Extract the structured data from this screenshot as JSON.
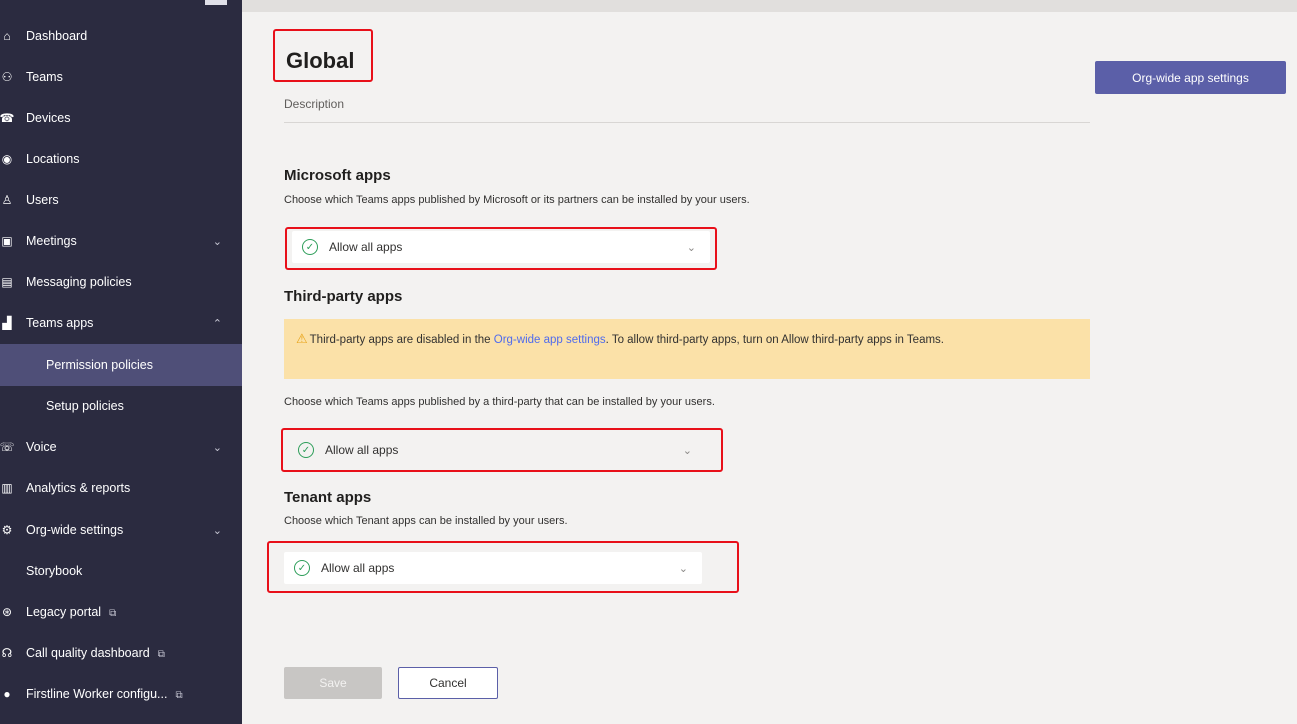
{
  "sidebar": {
    "items": [
      {
        "label": "Dashboard",
        "icon": "home-icon"
      },
      {
        "label": "Teams",
        "icon": "teams-icon"
      },
      {
        "label": "Devices",
        "icon": "devices-icon"
      },
      {
        "label": "Locations",
        "icon": "globe-icon"
      },
      {
        "label": "Users",
        "icon": "user-icon"
      },
      {
        "label": "Meetings",
        "icon": "calendar-icon",
        "chevron": "down"
      },
      {
        "label": "Messaging policies",
        "icon": "chat-icon"
      },
      {
        "label": "Teams apps",
        "icon": "apps-icon",
        "chevron": "up"
      },
      {
        "label": "Permission policies",
        "sub": true,
        "active": true
      },
      {
        "label": "Setup policies",
        "sub": true
      },
      {
        "label": "Voice",
        "icon": "phone-icon",
        "chevron": "down"
      },
      {
        "label": "Analytics & reports",
        "icon": "chart-icon"
      },
      {
        "label": "Org-wide settings",
        "icon": "gear-icon",
        "chevron": "down"
      },
      {
        "label": "Storybook"
      },
      {
        "label": "Legacy portal",
        "icon": "portal-icon",
        "external": true
      },
      {
        "label": "Call quality dashboard",
        "icon": "call-quality-icon",
        "external": true
      },
      {
        "label": "Firstline Worker configu...",
        "icon": "worker-icon",
        "external": true
      }
    ]
  },
  "page": {
    "title": "Global",
    "description_label": "Description",
    "org_wide_button": "Org-wide app settings"
  },
  "microsoft_apps": {
    "title": "Microsoft apps",
    "subtitle": "Choose which Teams apps published by Microsoft or its partners can be installed by your users.",
    "dropdown_value": "Allow all apps"
  },
  "third_party_apps": {
    "title": "Third-party apps",
    "warning_pre": "Third-party apps are disabled in the ",
    "warning_link": "Org-wide app settings",
    "warning_post": ". To allow third-party apps, turn on Allow third-party apps in Teams.",
    "subtitle": "Choose which Teams apps published by a third-party that can be installed by your users.",
    "dropdown_value": "Allow all apps"
  },
  "tenant_apps": {
    "title": "Tenant apps",
    "subtitle": "Choose which Tenant apps can be installed by your users.",
    "dropdown_value": "Allow all apps"
  },
  "actions": {
    "save_label": "Save",
    "cancel_label": "Cancel"
  },
  "colors": {
    "sidebar_bg": "#2b2b40",
    "sidebar_active": "#4f4f78",
    "accent": "#5b5fa8",
    "highlight_box": "#e8101a",
    "warning_bg": "#fbe1a8",
    "check_green": "#2e9e5a"
  }
}
